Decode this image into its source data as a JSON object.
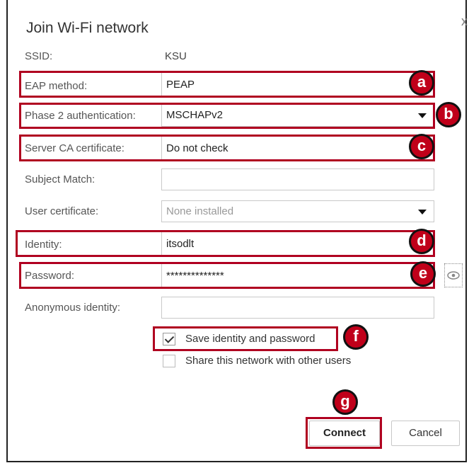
{
  "dialog": {
    "title": "Join Wi-Fi network",
    "close_glyph": "x"
  },
  "fields": {
    "ssid": {
      "label": "SSID:",
      "value": "KSU"
    },
    "eap_method": {
      "label": "EAP method:",
      "value": "PEAP"
    },
    "phase2": {
      "label": "Phase 2 authentication:",
      "value": "MSCHAPv2"
    },
    "server_ca": {
      "label": "Server CA certificate:",
      "value": "Do not check"
    },
    "subject_match": {
      "label": "Subject Match:",
      "value": ""
    },
    "user_cert": {
      "label": "User certificate:",
      "value": "None installed"
    },
    "identity": {
      "label": "Identity:",
      "value": "itsodlt"
    },
    "password": {
      "label": "Password:",
      "value": "**************"
    },
    "anonymous_identity": {
      "label": "Anonymous identity:",
      "value": ""
    }
  },
  "checkboxes": {
    "save_identity": {
      "label": "Save identity and password",
      "checked": true
    },
    "share_network": {
      "label": "Share this network with other users",
      "checked": false
    }
  },
  "buttons": {
    "connect": "Connect",
    "cancel": "Cancel"
  },
  "callouts": {
    "a": "a",
    "b": "b",
    "c": "c",
    "d": "d",
    "e": "e",
    "f": "f",
    "g": "g"
  },
  "colors": {
    "highlight": "#b00020",
    "badge": "#c0001a"
  },
  "icons": {
    "password_reveal": "eye-icon",
    "dropdown": "triangle-down-icon"
  }
}
